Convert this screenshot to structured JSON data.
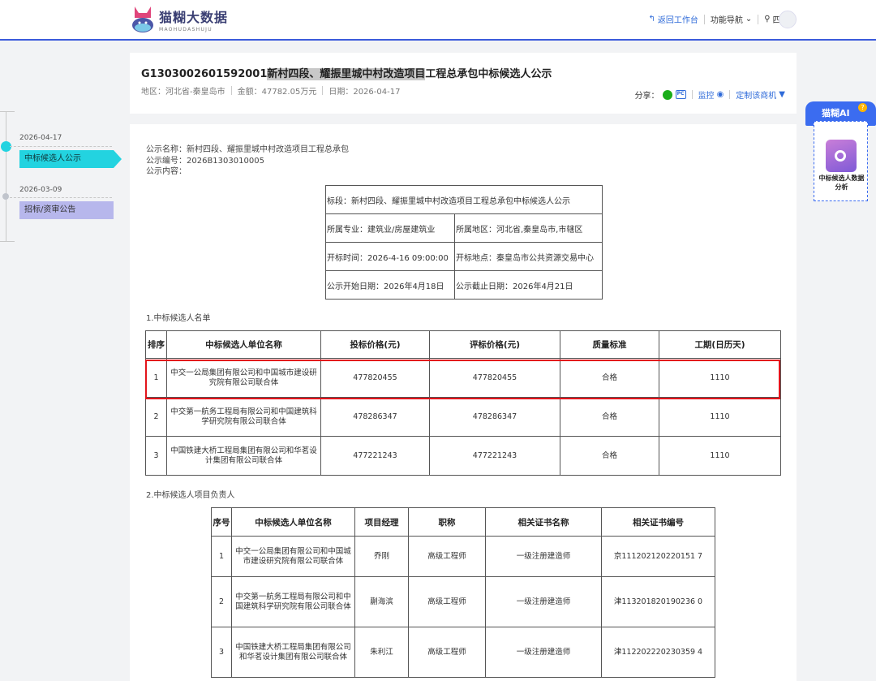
{
  "brand": {
    "name_cn": "猫糊大数据",
    "name_en": "MAOHUDASHUJU"
  },
  "topnav": {
    "back": "返回工作台",
    "nav": "功能导航",
    "region": "四川"
  },
  "header": {
    "code": "G1303002601592001",
    "title_highlight": "新村四段、耀振里城中村改造项目",
    "title_rest": "工程总承包中标候选人公示",
    "region": "地区：河北省-秦皇岛市",
    "amount": "金额：47782.05万元",
    "date": "日期：2026-04-17",
    "share": "分享：",
    "pc_badge": "PC",
    "monitor": "监控",
    "custom": "定制该商机"
  },
  "timeline": {
    "items": [
      {
        "date": "2026-04-17",
        "label": "中标候选人公示"
      },
      {
        "date": "2026-03-09",
        "label": "招标/资审公告"
      }
    ]
  },
  "ai": {
    "title": "猫糊AI",
    "badge": "?",
    "label": "中标候选人数据分析"
  },
  "notice": {
    "name": "公示名称：新村四段、耀振里城中村改造项目工程总承包",
    "number": "公示编号：2026B1303010005",
    "content": "公示内容：",
    "info": {
      "section": "标段：新村四段、耀振里城中村改造项目工程总承包中标候选人公示",
      "major": "所属专业：建筑业/房屋建筑业",
      "area": "所属地区：河北省,秦皇岛市,市辖区",
      "open_time": "开标时间：2026-4-16  09:00:00",
      "open_place": "开标地点：秦皇岛市公共资源交易中心",
      "start": "公示开始日期：2026年4月18日",
      "end": "公示截止日期：2026年4月21日"
    }
  },
  "candidates": {
    "title": "1.中标候选人名单",
    "headers": [
      "排序",
      "中标候选人单位名称",
      "投标价格(元)",
      "评标价格(元)",
      "质量标准",
      "工期(日历天)"
    ],
    "rows": [
      {
        "rank": "1",
        "name": "中交一公局集团有限公司和中国城市建设研究院有限公司联合体",
        "bid": "477820455",
        "eval": "477820455",
        "quality": "合格",
        "period": "1110"
      },
      {
        "rank": "2",
        "name": "中交第一航务工程局有限公司和中国建筑科学研究院有限公司联合体",
        "bid": "478286347",
        "eval": "478286347",
        "quality": "合格",
        "period": "1110"
      },
      {
        "rank": "3",
        "name": "中国铁建大桥工程局集团有限公司和华茗设计集团有限公司联合体",
        "bid": "477221243",
        "eval": "477221243",
        "quality": "合格",
        "period": "1110"
      }
    ]
  },
  "managers": {
    "title": "2.中标候选人项目负责人",
    "headers": [
      "序号",
      "中标候选人单位名称",
      "项目经理",
      "职称",
      "相关证书名称",
      "相关证书编号"
    ],
    "rows": [
      {
        "no": "1",
        "name": "中交一公局集团有限公司和中国城市建设研究院有限公司联合体",
        "manager": "乔刚",
        "title": "高级工程师",
        "cert": "一级注册建造师",
        "cert_no": "京111202120220151 7"
      },
      {
        "no": "2",
        "name": "中交第一航务工程局有限公司和中国建筑科学研究院有限公司联合体",
        "manager": "蒯海滨",
        "title": "高级工程师",
        "cert": "一级注册建造师",
        "cert_no": "津113201820190236 0"
      },
      {
        "no": "3",
        "name": "中国铁建大桥工程局集团有限公司和华茗设计集团有限公司联合体",
        "manager": "朱利江",
        "title": "高级工程师",
        "cert": "一级注册建造师",
        "cert_no": "津112202220230359 4"
      }
    ]
  }
}
